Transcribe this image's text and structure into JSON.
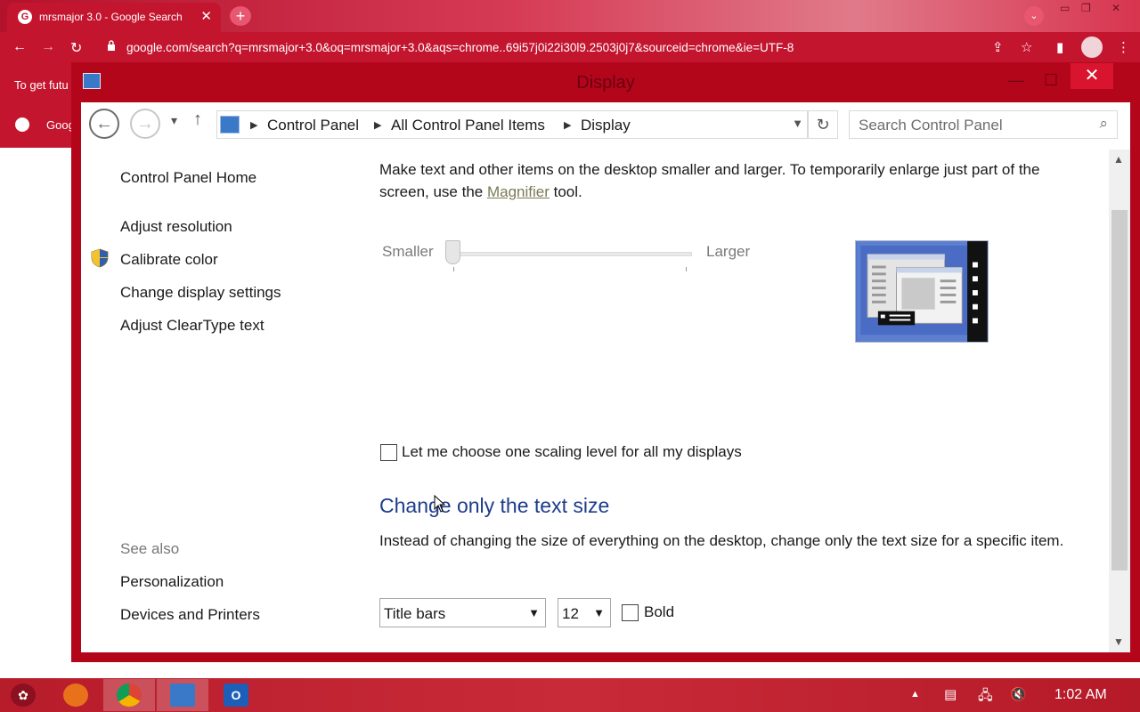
{
  "browser": {
    "tab_title": "mrsmajor 3.0 - Google Search",
    "tab_favicon": "G",
    "tab_close": "✕",
    "new_tab": "+",
    "url": "google.com/search?q=mrsmajor+3.0&oq=mrsmajor+3.0&aqs=chrome..69i57j0i22i30l9.2503j0j7&sourceid=chrome&ie=UTF-8",
    "accent_color": "#c4152f"
  },
  "page_behind": {
    "banner_text": "To get futu",
    "result_text": "Goog"
  },
  "window": {
    "title": "Display",
    "close": "✕"
  },
  "address_bar": {
    "crumbs": [
      "Control Panel",
      "All Control Panel Items",
      "Display"
    ],
    "search_placeholder": "Search Control Panel"
  },
  "sidebar": {
    "home": "Control Panel Home",
    "items": [
      "Adjust resolution",
      "Calibrate color",
      "Change display settings",
      "Adjust ClearType text"
    ],
    "see_also_heading": "See also",
    "see_also": [
      "Personalization",
      "Devices and Printers"
    ]
  },
  "main": {
    "description_pre": "Make text and other items on the desktop smaller and larger. To temporarily enlarge just part of the screen, use the ",
    "magnifier_link": "Magnifier",
    "description_post": " tool.",
    "slider_min_label": "Smaller",
    "slider_max_label": "Larger",
    "slider_value": 0,
    "scaling_checkbox_label": "Let me choose one scaling level for all my displays",
    "scaling_checkbox_checked": false,
    "text_size_heading": "Change only the text size",
    "text_size_description": "Instead of changing the size of everything on the desktop, change only the text size for a specific item.",
    "item_select_value": "Title bars",
    "size_select_value": "12",
    "bold_label": "Bold",
    "bold_checked": false
  },
  "taskbar": {
    "clock": "1:02 AM",
    "apps": [
      "firefox-icon",
      "chrome-icon",
      "control-panel-icon",
      "outlook-icon"
    ],
    "outlook_glyph": "O"
  }
}
